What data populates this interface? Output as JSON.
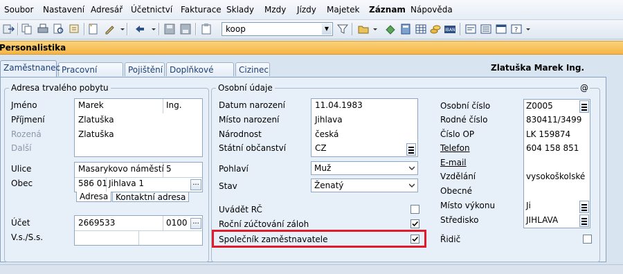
{
  "menu": [
    "Soubor",
    "Nastavení",
    "Adresář",
    "Účetnictví",
    "Fakturace",
    "Sklady",
    "Mzdy",
    "Jízdy",
    "Majetek",
    "Záznam",
    "Nápověda"
  ],
  "toolbar": {
    "search_value": "koop",
    "icons": [
      "exit-icon",
      "copy-icon",
      "print-icon",
      "print-preview-icon",
      "new-record-icon",
      "edit-icon",
      "back-icon",
      "save-icon",
      "disk-icon",
      "clipboard-icon",
      "filter-icon",
      "folder-icon",
      "money-icon",
      "calculator-icon",
      "table-icon",
      "coins-icon",
      "iban-icon",
      "form-icon",
      "list-icon",
      "window-icon",
      "help-icon"
    ]
  },
  "window_title": "Personalistika",
  "tabs": [
    "Zaměstnanec",
    "Pracovní poměr",
    "Pojištění",
    "Doplňkové údaje",
    "Cizinec"
  ],
  "employee_name": "Zlatuška Marek Ing.",
  "address": {
    "group_title": "Adresa trvalého pobytu",
    "labels": {
      "first_name": "Jméno",
      "last_name": "Příjmení",
      "born": "Rozená",
      "other": "Další",
      "street": "Ulice",
      "city": "Obec",
      "account": "Účet",
      "vs_ss": "V.s./S.s."
    },
    "first_name": "Marek",
    "title": "Ing.",
    "last_name": "Zlatuška",
    "born_as": "Zlatuška",
    "street": "Masarykovo náměstí",
    "house_no": "5",
    "zip": "586 01",
    "city": "Jihlava 1",
    "subtabs": [
      "Adresa",
      "Kontaktní adresa"
    ],
    "account": "2669533",
    "bank_code": "0100"
  },
  "personal": {
    "group_title": "Osobní údaje",
    "at_sign": "@",
    "labels": {
      "birth_date": "Datum narození",
      "birth_place": "Místo narození",
      "nationality": "Národnost",
      "citizenship": "Státní občanství",
      "gender": "Pohlaví",
      "status": "Stav",
      "show_rc": "Uvádět RČ",
      "annual_tax": "Roční zúčtování záloh",
      "partner": "Společník zaměstnavatele"
    },
    "birth_date": "11.04.1983",
    "birth_place": "Jihlava",
    "nationality": "česká",
    "citizenship": "CZ",
    "gender": "Muž",
    "status": "Ženatý",
    "show_rc": false,
    "annual_tax": true,
    "partner": true
  },
  "ids": {
    "labels": {
      "personal_no": "Osobní číslo",
      "birth_no": "Rodné číslo",
      "id_card": "Číslo OP",
      "phone": "Telefon",
      "email": "E-mail",
      "education": "Vzdělání",
      "general": "Obecné",
      "work_place": "Místo výkonu",
      "center": "Středisko",
      "driver": "Řidič"
    },
    "personal_no": "Z0005",
    "birth_no": "830411/3499",
    "id_card": "LK 159874",
    "phone": "604 158 851",
    "education": "vysokoškolské",
    "work_place": "Ji",
    "center": "JIHLAVA",
    "driver": false
  },
  "colors": {
    "highlight": "#e21b2a",
    "title_bar": "#f5b544"
  }
}
